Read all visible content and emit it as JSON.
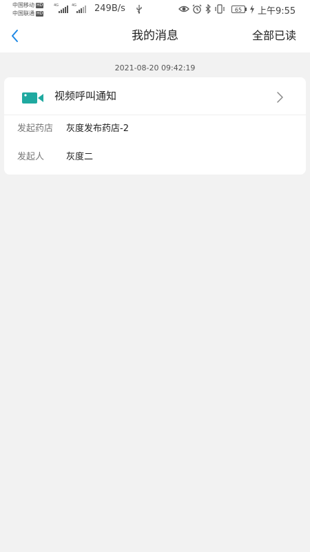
{
  "status_bar": {
    "carrier_1": "中国移动",
    "carrier_2": "中国联通",
    "hd_badge": "HD",
    "signal_1": "4G",
    "signal_2": "4G",
    "net_speed": "249B/s",
    "battery_level": "65",
    "time": "上午9:55"
  },
  "nav": {
    "title": "我的消息",
    "mark_all_read": "全部已读"
  },
  "message": {
    "timestamp": "2021-08-20 09:42:19",
    "title": "视频呼叫通知",
    "icon": "video-camera-icon",
    "fields": [
      {
        "label": "发起药店",
        "value": "灰度发布药店-2"
      },
      {
        "label": "发起人",
        "value": "灰度二"
      }
    ]
  },
  "colors": {
    "accent": "#1e88e5",
    "icon_teal": "#1fa9a0",
    "background": "#f2f2f2",
    "card": "#ffffff"
  }
}
